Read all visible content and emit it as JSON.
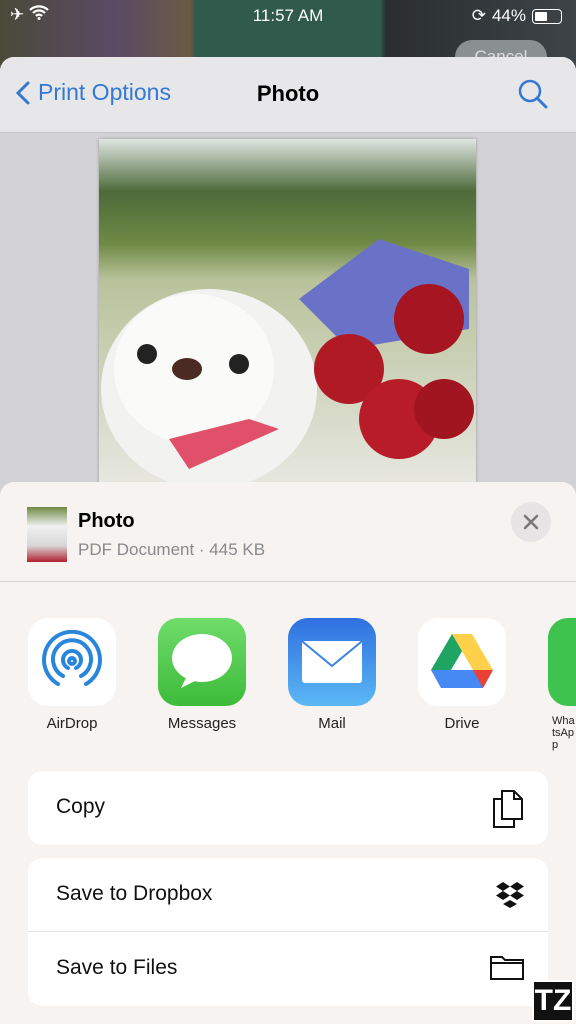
{
  "status_bar": {
    "time": "11:57 AM",
    "battery": "44%",
    "battery_level": 0.44
  },
  "background": {
    "cancel_label": "Cancel"
  },
  "nav": {
    "back_label": "Print Options",
    "title": "Photo"
  },
  "share_sheet": {
    "file_name": "Photo",
    "file_info": "PDF Document · 445 KB",
    "apps": [
      {
        "label": "AirDrop"
      },
      {
        "label": "Messages"
      },
      {
        "label": "Mail"
      },
      {
        "label": "Drive"
      },
      {
        "label": "WhatsApp"
      }
    ],
    "actions": [
      {
        "label": "Copy",
        "icon": "copy-icon"
      },
      {
        "label": "Save to Dropbox",
        "icon": "dropbox-icon"
      },
      {
        "label": "Save to Files",
        "icon": "folder-icon"
      }
    ]
  },
  "watermark": "TZ",
  "colors": {
    "accent": "#3478d4"
  }
}
